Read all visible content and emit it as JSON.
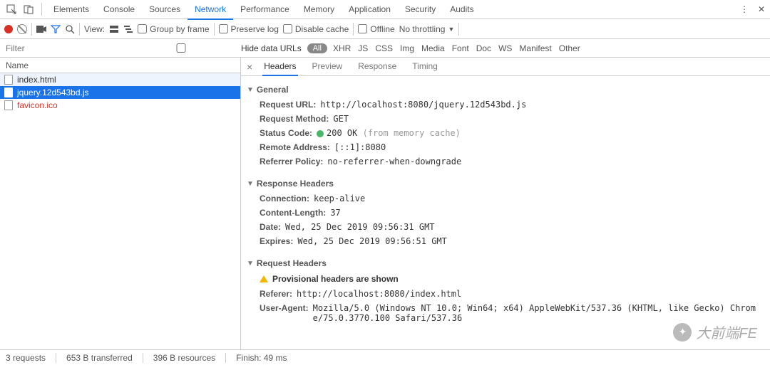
{
  "tabs": {
    "main": [
      "Elements",
      "Console",
      "Sources",
      "Network",
      "Performance",
      "Memory",
      "Application",
      "Security",
      "Audits"
    ],
    "active": "Network"
  },
  "toolbar": {
    "view_label": "View:",
    "group_by_frame": "Group by frame",
    "preserve_log": "Preserve log",
    "disable_cache": "Disable cache",
    "offline": "Offline",
    "throttling": "No throttling"
  },
  "filter": {
    "placeholder": "Filter",
    "hide_data": "Hide data URLs",
    "all": "All",
    "types": [
      "XHR",
      "JS",
      "CSS",
      "Img",
      "Media",
      "Font",
      "Doc",
      "WS",
      "Manifest",
      "Other"
    ]
  },
  "left": {
    "header": "Name",
    "rows": [
      {
        "name": "index.html",
        "selected": false
      },
      {
        "name": "jquery.12d543bd.js",
        "selected": true
      },
      {
        "name": "favicon.ico",
        "selected": false,
        "fav": true
      }
    ]
  },
  "detail_tabs": {
    "items": [
      "Headers",
      "Preview",
      "Response",
      "Timing"
    ],
    "active": "Headers"
  },
  "sections": {
    "general": {
      "title": "General",
      "request_url_k": "Request URL:",
      "request_url_v": "http://localhost:8080/jquery.12d543bd.js",
      "method_k": "Request Method:",
      "method_v": "GET",
      "status_k": "Status Code:",
      "status_v": "200 OK",
      "status_note": "(from memory cache)",
      "remote_k": "Remote Address:",
      "remote_v": "[::1]:8080",
      "referrer_k": "Referrer Policy:",
      "referrer_v": "no-referrer-when-downgrade"
    },
    "response": {
      "title": "Response Headers",
      "connection_k": "Connection:",
      "connection_v": "keep-alive",
      "clen_k": "Content-Length:",
      "clen_v": "37",
      "date_k": "Date:",
      "date_v": "Wed, 25 Dec 2019 09:56:31 GMT",
      "expires_k": "Expires:",
      "expires_v": "Wed, 25 Dec 2019 09:56:51 GMT"
    },
    "request": {
      "title": "Request Headers",
      "provisional": "Provisional headers are shown",
      "referer_k": "Referer:",
      "referer_v": "http://localhost:8080/index.html",
      "ua_k": "User-Agent:",
      "ua_v": "Mozilla/5.0 (Windows NT 10.0; Win64; x64) AppleWebKit/537.36 (KHTML, like Gecko) Chrome/75.0.3770.100 Safari/537.36"
    }
  },
  "status": {
    "requests": "3 requests",
    "transferred": "653 B transferred",
    "resources": "396 B resources",
    "finish": "Finish: 49 ms"
  },
  "watermark": "大前端FE"
}
